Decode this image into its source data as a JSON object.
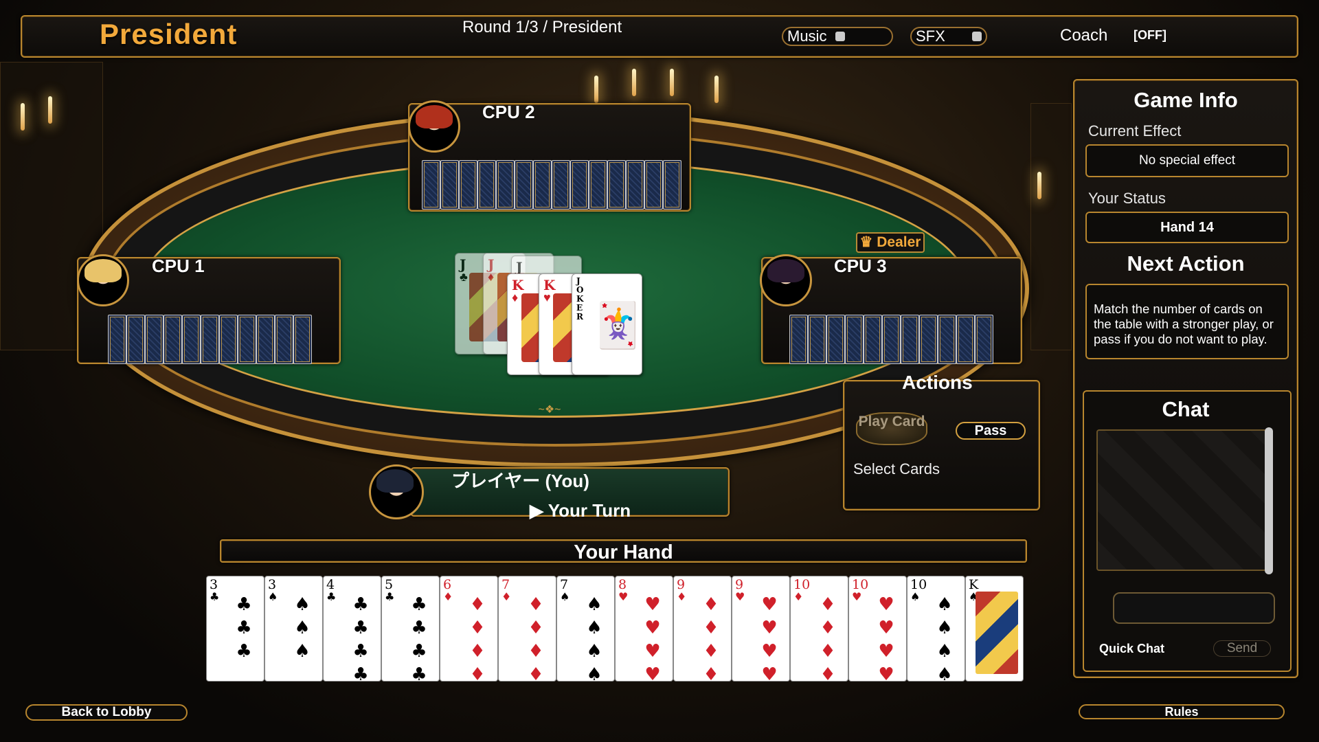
{
  "header": {
    "title": "President",
    "round": "Round 1/3 / President",
    "music_label": "Music",
    "sfx_label": "SFX",
    "coach_label": "Coach",
    "coach_state": "[OFF]"
  },
  "players": {
    "cpu2": {
      "name": "CPU 2",
      "card_count": 14
    },
    "cpu1": {
      "name": "CPU 1",
      "card_count": 11
    },
    "cpu3": {
      "name": "CPU 3",
      "card_count": 11
    },
    "you": {
      "name": "プレイヤー (You)",
      "turn": "▶ Your Turn"
    }
  },
  "dealer_badge": "Dealer",
  "table_pile": [
    {
      "rank": "J",
      "suit": "♣",
      "color": "black"
    },
    {
      "rank": "J",
      "suit": "♦",
      "color": "red"
    },
    {
      "rank": "J",
      "suit": "♠",
      "color": "black"
    },
    {
      "rank": "K",
      "suit": "♦",
      "color": "red"
    },
    {
      "rank": "K",
      "suit": "♥",
      "color": "red"
    },
    {
      "rank": "JOKER",
      "suit": "",
      "color": "black"
    }
  ],
  "actions": {
    "title": "Actions",
    "play_label": "Play Card",
    "pass_label": "Pass",
    "select_label": "Select Cards"
  },
  "hand": {
    "title": "Your Hand",
    "cards": [
      {
        "rank": "3",
        "suit": "♣",
        "color": "black"
      },
      {
        "rank": "3",
        "suit": "♠",
        "color": "black"
      },
      {
        "rank": "4",
        "suit": "♣",
        "color": "black"
      },
      {
        "rank": "5",
        "suit": "♣",
        "color": "black"
      },
      {
        "rank": "6",
        "suit": "♦",
        "color": "red"
      },
      {
        "rank": "7",
        "suit": "♦",
        "color": "red"
      },
      {
        "rank": "7",
        "suit": "♠",
        "color": "black"
      },
      {
        "rank": "8",
        "suit": "♥",
        "color": "red"
      },
      {
        "rank": "9",
        "suit": "♦",
        "color": "red"
      },
      {
        "rank": "9",
        "suit": "♥",
        "color": "red"
      },
      {
        "rank": "10",
        "suit": "♦",
        "color": "red"
      },
      {
        "rank": "10",
        "suit": "♥",
        "color": "red"
      },
      {
        "rank": "10",
        "suit": "♠",
        "color": "black"
      },
      {
        "rank": "K",
        "suit": "♠",
        "color": "black"
      }
    ]
  },
  "sidebar": {
    "game_info_title": "Game Info",
    "current_effect_label": "Current Effect",
    "current_effect_value": "No special effect",
    "status_label": "Your Status",
    "status_value": "Hand 14",
    "next_action_title": "Next Action",
    "next_action_text": "Match the number of cards on the table with a stronger play, or pass if you do not want to play.",
    "chat_title": "Chat",
    "quick_chat_label": "Quick Chat",
    "send_label": "Send"
  },
  "footer": {
    "back_label": "Back to Lobby",
    "rules_label": "Rules"
  },
  "colors": {
    "accent_gold": "#f2a93b",
    "frame_gold": "#b8862e",
    "felt_green": "#11502a"
  }
}
